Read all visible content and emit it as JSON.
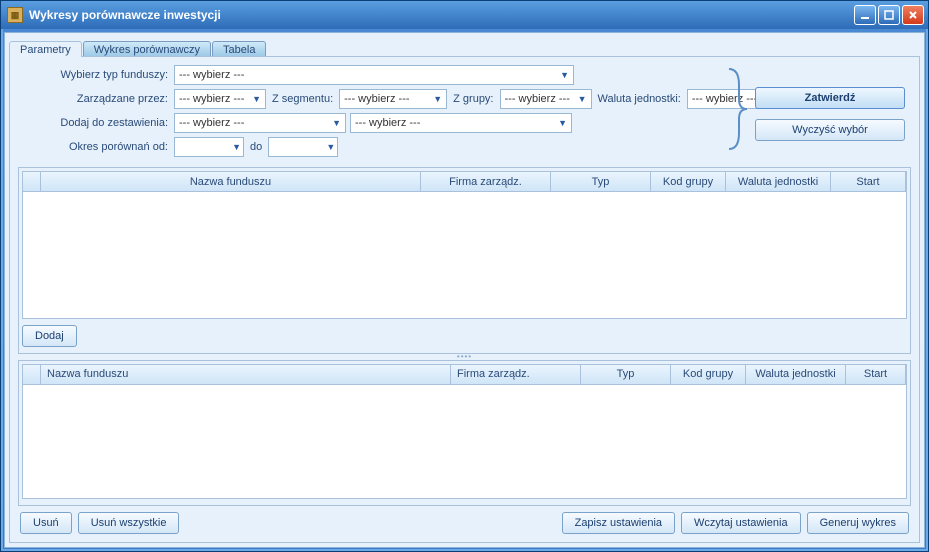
{
  "window": {
    "title": "Wykresy porównawcze inwestycji"
  },
  "tabs": {
    "t0": "Parametry",
    "t1": "Wykres porównawczy",
    "t2": "Tabela"
  },
  "labels": {
    "typFunduszy": "Wybierz typ funduszy:",
    "zarzadzane": "Zarządzane przez:",
    "zSegmentu": "Z segmentu:",
    "zGrupy": "Z grupy:",
    "waluta": "Waluta jednostki:",
    "dodaj": "Dodaj do zestawienia:",
    "okresOd": "Okres porównań od:",
    "do": "do"
  },
  "selects": {
    "placeholder": "--- wybierz ---",
    "date1": "",
    "date2": ""
  },
  "buttons": {
    "zatwierdz": "Zatwierdź",
    "wyczysc": "Wyczyść wybór",
    "dodaj": "Dodaj",
    "usun": "Usuń",
    "usunWszystkie": "Usuń wszystkie",
    "zapisz": "Zapisz ustawienia",
    "wczytaj": "Wczytaj ustawienia",
    "generuj": "Generuj wykres"
  },
  "columns": {
    "nazwa": "Nazwa funduszu",
    "firma": "Firma zarządz.",
    "typ": "Typ",
    "kod": "Kod grupy",
    "waluta": "Waluta jednostki",
    "start": "Start"
  }
}
